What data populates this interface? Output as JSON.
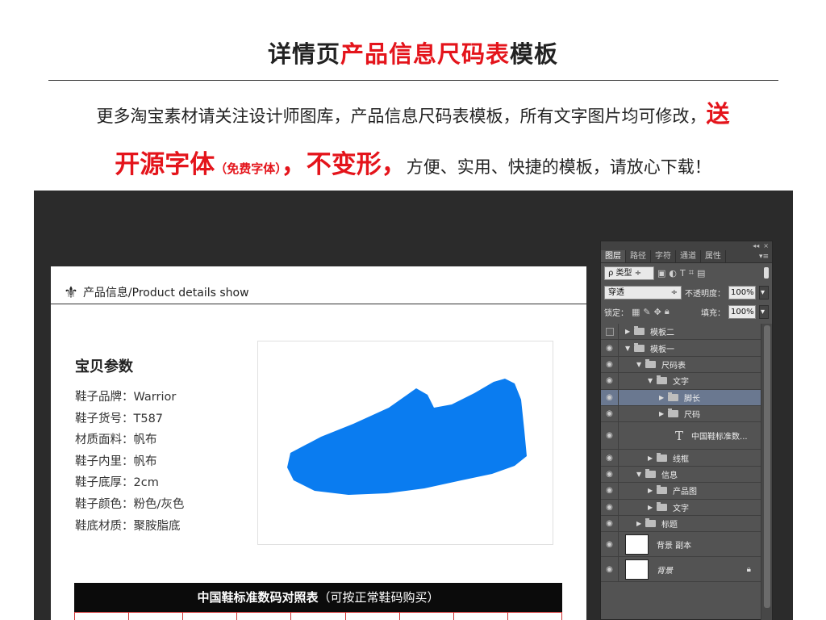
{
  "headline": {
    "part1": "详情页",
    "part2": "产品信息尺码表",
    "part3": "模板"
  },
  "intro": {
    "line1_text": "更多淘宝素材请关注设计师图库，产品信息尺码表模板，所有文字图片均可修改，",
    "line1_red": "送",
    "line2_red1": "开源字体",
    "line2_small": "（免费字体）",
    "line2_red2": "，不变形，",
    "line2_text": "方便、实用、快捷的模板，请放心下载！"
  },
  "canvas": {
    "section_icon": "fleur-de-lis-icon",
    "section_title": "产品信息/Product details show",
    "params_title": "宝贝参数",
    "params": [
      "鞋子品牌：Warrior",
      "鞋子货号：T587",
      "材质面料：帆布",
      "鞋子内里：帆布",
      "鞋子底厚：2cm",
      "鞋子颜色：粉色/灰色",
      "鞋底材质：聚胺脂底"
    ],
    "shoe_color": "#0a7cf0",
    "size_table_title_bold": "中国鞋标准数码对照表",
    "size_table_title_normal": "（可按正常鞋码购买）"
  },
  "panel": {
    "tabs": [
      "图层",
      "路径",
      "字符",
      "通道",
      "属性"
    ],
    "filter_kind": "ρ 类型",
    "blend_mode": "穿透",
    "opacity_label": "不透明度：",
    "opacity_value": "100%",
    "lock_label": "锁定：",
    "fill_label": "填充：",
    "fill_value": "100%",
    "layers": [
      {
        "name": "模板二",
        "indent": 0,
        "type": "group",
        "expanded": false,
        "visible": false
      },
      {
        "name": "模板一",
        "indent": 0,
        "type": "group",
        "expanded": true,
        "visible": true
      },
      {
        "name": "尺码表",
        "indent": 1,
        "type": "group",
        "expanded": true,
        "visible": true
      },
      {
        "name": "文字",
        "indent": 2,
        "type": "group",
        "expanded": true,
        "visible": true
      },
      {
        "name": "脚长",
        "indent": 3,
        "type": "group",
        "expanded": false,
        "visible": true,
        "selected": true
      },
      {
        "name": "尺码",
        "indent": 3,
        "type": "group",
        "expanded": false,
        "visible": true
      },
      {
        "name": "中国鞋标准数...",
        "indent": 3,
        "type": "text",
        "visible": true
      },
      {
        "name": "线框",
        "indent": 2,
        "type": "group",
        "expanded": false,
        "visible": true
      },
      {
        "name": "信息",
        "indent": 1,
        "type": "group",
        "expanded": true,
        "visible": true
      },
      {
        "name": "产品图",
        "indent": 2,
        "type": "group",
        "expanded": false,
        "visible": true
      },
      {
        "name": "文字",
        "indent": 2,
        "type": "group",
        "expanded": false,
        "visible": true
      },
      {
        "name": "标题",
        "indent": 1,
        "type": "group",
        "expanded": false,
        "visible": true
      },
      {
        "name": "背景 副本",
        "indent": 0,
        "type": "image",
        "visible": true
      },
      {
        "name": "背景",
        "indent": 0,
        "type": "image",
        "visible": true,
        "locked": true
      }
    ]
  }
}
